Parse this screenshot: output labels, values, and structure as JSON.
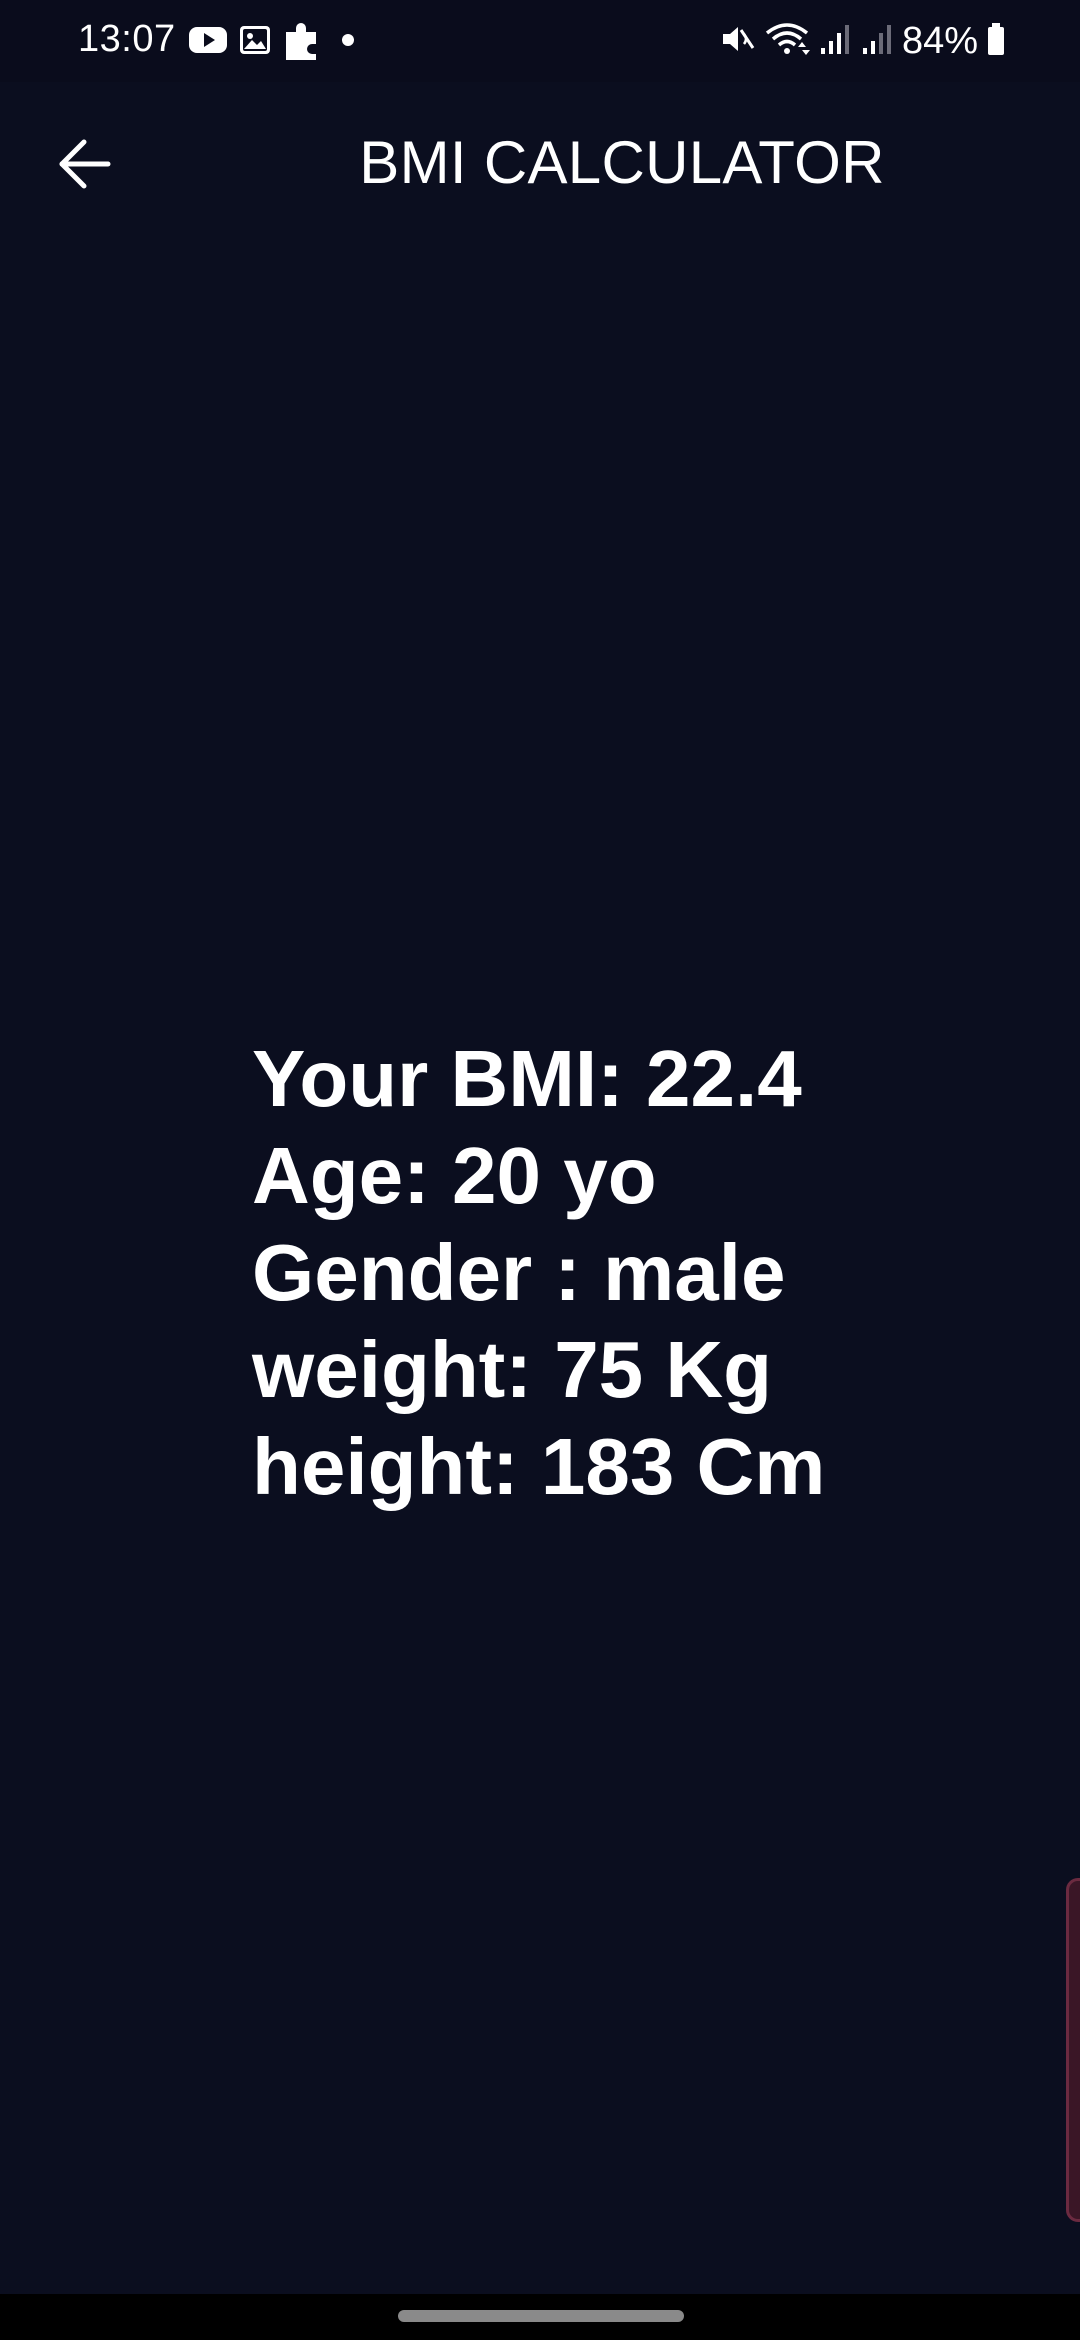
{
  "status_bar": {
    "time": "13:07",
    "battery": "84%",
    "left_icons": [
      "youtube-icon",
      "gallery-icon",
      "puzzle-icon",
      "dot-icon"
    ],
    "right_icons": [
      "mute-icon",
      "wifi-icon",
      "signal-icon",
      "signal-icon",
      "battery-icon"
    ]
  },
  "app_bar": {
    "title": "BMI CALCULATOR",
    "back_icon": "arrow-back-icon"
  },
  "result": {
    "bmi": "Your BMI: 22.4",
    "age": "Age: 20 yo",
    "gender": "Gender : male",
    "weight": "weight: 75 Kg",
    "height": "height: 183 Cm"
  },
  "colors": {
    "background": "#0b0e1f",
    "text": "#ffffff",
    "edge_handle": "#3a1626"
  }
}
